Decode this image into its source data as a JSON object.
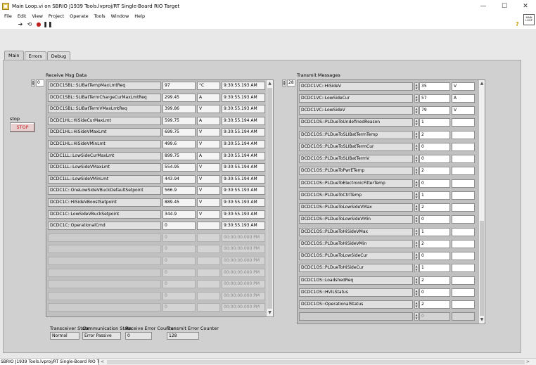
{
  "window": {
    "title": "Main Loop.vi on SBRIO J1939 Tools.lvproj/RT Single-Board RIO Target",
    "minimize": "—",
    "maximize": "☐",
    "close": "✕"
  },
  "menu": [
    "File",
    "Edit",
    "View",
    "Project",
    "Operate",
    "Tools",
    "Window",
    "Help"
  ],
  "vi_icon_text": "MAIN LOOP",
  "tabs": [
    {
      "label": "Main",
      "active": true
    },
    {
      "label": "Errors",
      "active": false
    },
    {
      "label": "Debug",
      "active": false
    }
  ],
  "stop": {
    "label": "stop",
    "button": "STOP"
  },
  "receive": {
    "label": "Receive Msg Data",
    "index": "0",
    "rows": [
      {
        "name": "DCDC1SBL::SLIBatTempMaxLmtReq",
        "value": "97",
        "unit": "°C",
        "time": "9:30:55.193 AM"
      },
      {
        "name": "DCDC1SBL::SLIBatTermChargeCurMaxLmtReq",
        "value": "299.45",
        "unit": "A",
        "time": "9:30:55.193 AM"
      },
      {
        "name": "DCDC1SBL::SLIBatTermVMaxLmtReq",
        "value": "399.86",
        "unit": "V",
        "time": "9:30:55.193 AM"
      },
      {
        "name": "DCDC1HL::HiSideCurMaxLmt",
        "value": "599.75",
        "unit": "A",
        "time": "9:30:55.194 AM"
      },
      {
        "name": "DCDC1HL::HiSideVMaxLmt",
        "value": "699.75",
        "unit": "V",
        "time": "9:30:55.194 AM"
      },
      {
        "name": "DCDC1HL::HiSideVMinLmt",
        "value": "499.6",
        "unit": "V",
        "time": "9:30:55.194 AM"
      },
      {
        "name": "DCDC1LL::LowSideCurMaxLmt",
        "value": "899.75",
        "unit": "A",
        "time": "9:30:55.194 AM"
      },
      {
        "name": "DCDC1LL::LowSideVMaxLmt",
        "value": "554.95",
        "unit": "V",
        "time": "9:30:55.194 AM"
      },
      {
        "name": "DCDC1LL::LowSideVMinLmt",
        "value": "443.94",
        "unit": "V",
        "time": "9:30:55.194 AM"
      },
      {
        "name": "DCDC1C::OneLowSideVBuckDefaultSetpoint",
        "value": "566.9",
        "unit": "V",
        "time": "9:30:55.193 AM"
      },
      {
        "name": "DCDC1C::HiSideVBoostSetpoint",
        "value": "889.45",
        "unit": "V",
        "time": "9:30:55.193 AM"
      },
      {
        "name": "DCDC1C::LowSideVBuckSetpoint",
        "value": "344.9",
        "unit": "V",
        "time": "9:30:55.193 AM"
      },
      {
        "name": "DCDC1C::OperationalCmd",
        "value": "0",
        "unit": "",
        "time": "9:30:55.193 AM"
      },
      {
        "name": "",
        "value": "0",
        "unit": "",
        "time": "00:00:00.000 PM"
      },
      {
        "name": "",
        "value": "0",
        "unit": "",
        "time": "00:00:00.000 PM"
      },
      {
        "name": "",
        "value": "0",
        "unit": "",
        "time": "00:00:00.000 PM"
      },
      {
        "name": "",
        "value": "0",
        "unit": "",
        "time": "00:00:00.000 PM"
      },
      {
        "name": "",
        "value": "0",
        "unit": "",
        "time": "00:00:00.000 PM"
      },
      {
        "name": "",
        "value": "0",
        "unit": "",
        "time": "00:00:00.000 PM"
      },
      {
        "name": "",
        "value": "0",
        "unit": "",
        "time": "00:00:00.000 PM"
      }
    ]
  },
  "transmit": {
    "label": "Transmit Messages",
    "index": "28",
    "rows": [
      {
        "name": "DCDC1VC::HiSideV",
        "value": "35",
        "unit": "V"
      },
      {
        "name": "DCDC1VC::LowSideCur",
        "value": "57",
        "unit": "A"
      },
      {
        "name": "DCDC1VC::LowSideV",
        "value": "79",
        "unit": "V"
      },
      {
        "name": "DCDC1OS::PLDueToUndefinedReason",
        "value": "1",
        "unit": ""
      },
      {
        "name": "DCDC1OS::PLDueToSLIBatTermTemp",
        "value": "2",
        "unit": ""
      },
      {
        "name": "DCDC1OS::PLDueToSLIBatTermCur",
        "value": "0",
        "unit": ""
      },
      {
        "name": "DCDC1OS::PLDueToSLIBatTermV",
        "value": "0",
        "unit": ""
      },
      {
        "name": "DCDC1OS::PLDueToPwrETemp",
        "value": "2",
        "unit": ""
      },
      {
        "name": "DCDC1OS::PLDueToElectronicFilterTemp",
        "value": "0",
        "unit": ""
      },
      {
        "name": "DCDC1OS::PLDueToCtrlTemp",
        "value": "1",
        "unit": ""
      },
      {
        "name": "DCDC1OS::PLDueToLowSideVMax",
        "value": "2",
        "unit": ""
      },
      {
        "name": "DCDC1OS::PLDueToLowSideVMin",
        "value": "0",
        "unit": ""
      },
      {
        "name": "DCDC1OS::PLDueToHiSideVMax",
        "value": "1",
        "unit": ""
      },
      {
        "name": "DCDC1OS::PLDueToHiSideVMin",
        "value": "2",
        "unit": ""
      },
      {
        "name": "DCDC1OS::PLDueToLowSideCur",
        "value": "0",
        "unit": ""
      },
      {
        "name": "DCDC1OS::PLDueToHiSideCur",
        "value": "1",
        "unit": ""
      },
      {
        "name": "DCDC1OS::LoadshedReq",
        "value": "2",
        "unit": ""
      },
      {
        "name": "DCDC1OS::HVILStatus",
        "value": "0",
        "unit": ""
      },
      {
        "name": "DCDC1OS::OperationalStatus",
        "value": "2",
        "unit": ""
      },
      {
        "name": "",
        "value": "0",
        "unit": ""
      }
    ]
  },
  "status": {
    "transceiver_label": "Transceiver State",
    "transceiver_value": "Normal",
    "comm_label": "Communication State",
    "comm_value": "Error Passive",
    "rx_err_label": "Receive Error Counter",
    "rx_err_value": "0",
    "tx_err_label": "Transmit Error Counter",
    "tx_err_value": "128"
  },
  "statusbar": {
    "target": "SBRIO J1939 Tools.lvproj/RT Single-Board RIO Target",
    "scroll_left": "<",
    "scroll_right": ">"
  }
}
